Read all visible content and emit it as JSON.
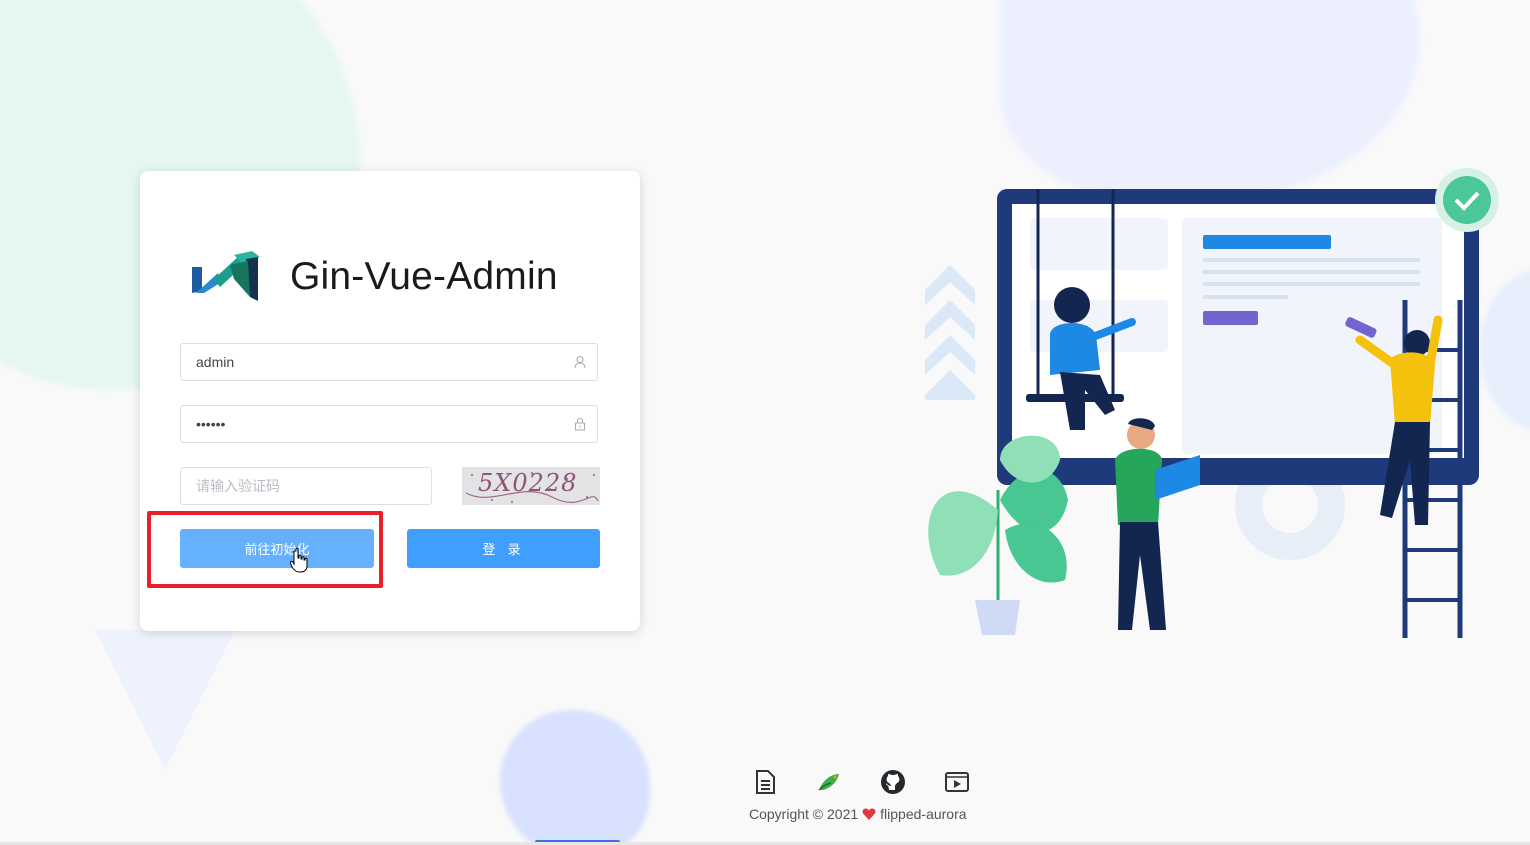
{
  "app": {
    "title": "Gin-Vue-Admin"
  },
  "login": {
    "username": {
      "value": "admin",
      "icon": "user-icon"
    },
    "password": {
      "value": "••••••",
      "icon": "lock-icon"
    },
    "captcha": {
      "placeholder": "请输入验证码",
      "image_text": "5X0228"
    },
    "buttons": {
      "init_label": "前往初始化",
      "login_label": "登 录"
    }
  },
  "footer": {
    "icons": [
      "document-icon",
      "bird-icon",
      "github-icon",
      "video-icon"
    ],
    "copyright_prefix": "Copyright © 2021",
    "copyright_owner": "flipped-aurora"
  },
  "colors": {
    "primary": "#409eff",
    "primary_light": "#66b1ff",
    "highlight": "#e8202a",
    "navy": "#1f3a7a"
  }
}
